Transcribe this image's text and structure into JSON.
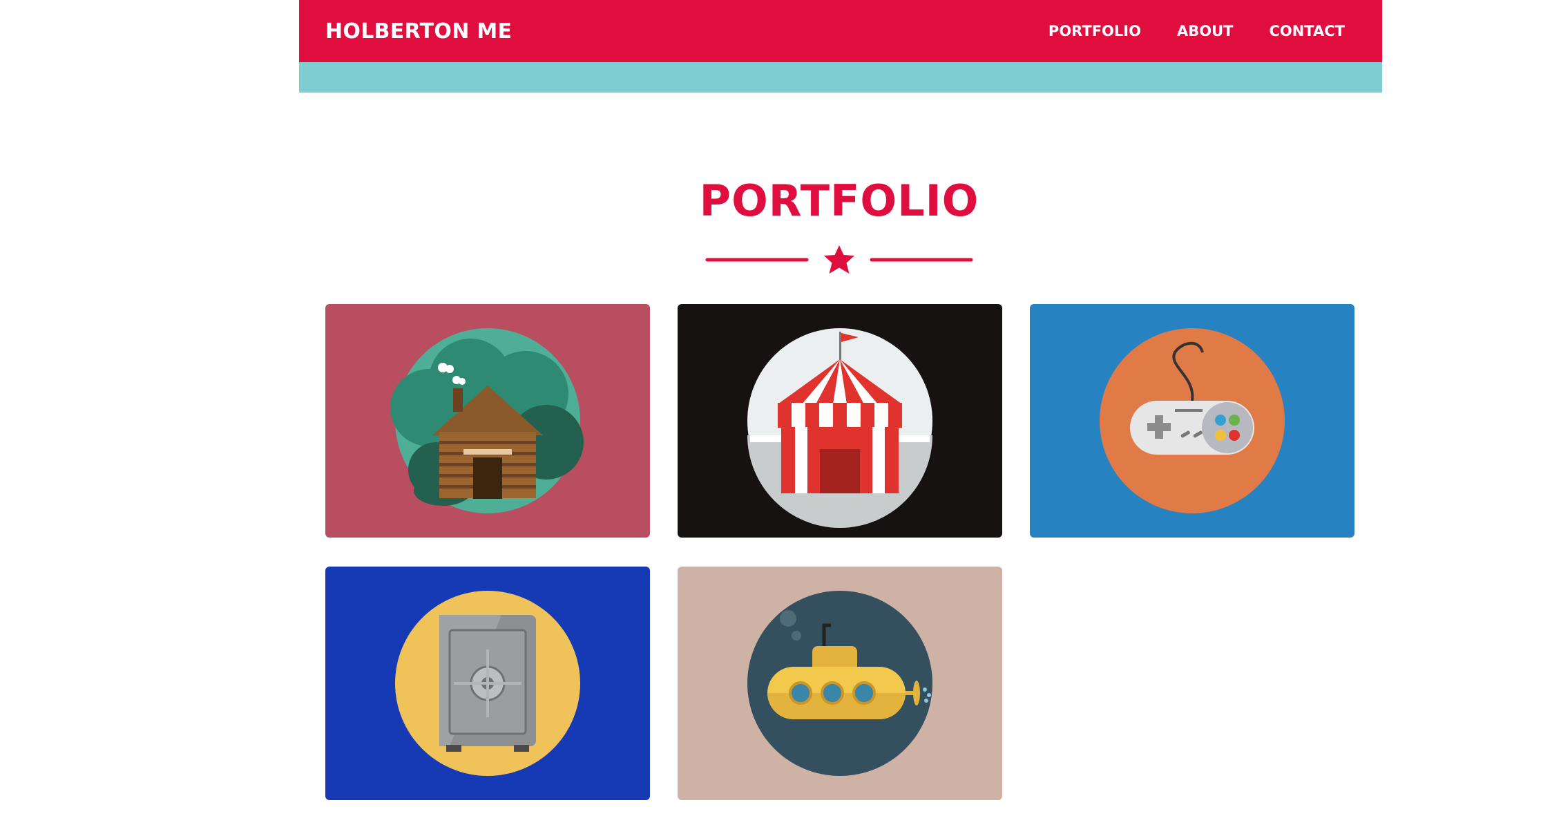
{
  "header": {
    "brand": "HOLBERTON ME",
    "nav": [
      "PORTFOLIO",
      "ABOUT",
      "CONTACT"
    ],
    "colors": {
      "primary": "#e00d3f",
      "accent": "#7dcdd1"
    }
  },
  "section": {
    "title": "PORTFOLIO",
    "divider_icon": "star-icon"
  },
  "portfolio": {
    "items": [
      {
        "icon": "log-cabin-icon",
        "background": "#b94e61"
      },
      {
        "icon": "circus-tent-icon",
        "background": "#151211"
      },
      {
        "icon": "game-controller-icon",
        "background": "#2682c1"
      },
      {
        "icon": "safe-icon",
        "background": "#163ab4"
      },
      {
        "icon": "submarine-icon",
        "background": "#ceb2a5"
      }
    ]
  }
}
